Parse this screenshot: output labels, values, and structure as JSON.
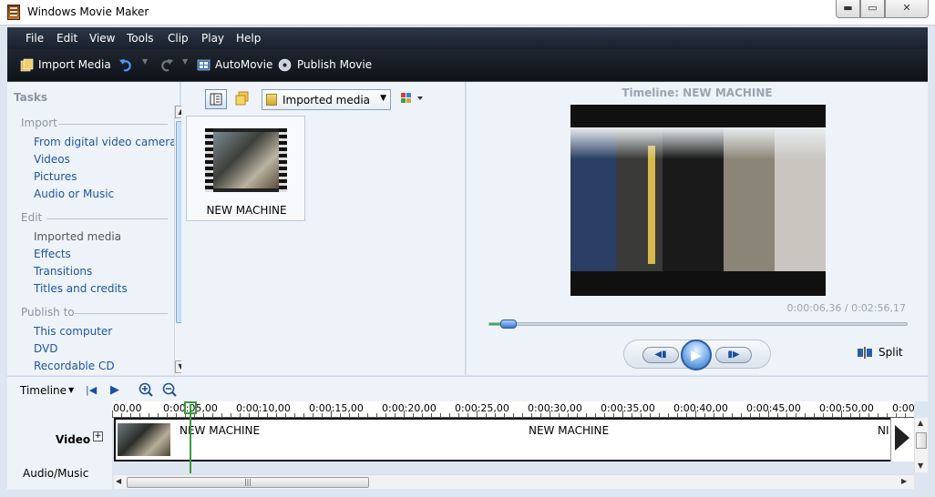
{
  "window": {
    "title": "Windows Movie Maker",
    "min_glyph": "▬",
    "max_glyph": "▭",
    "close_glyph": "✕"
  },
  "menu": [
    "File",
    "Edit",
    "View",
    "Tools",
    "Clip",
    "Play",
    "Help"
  ],
  "toolbar": {
    "import_media": "Import Media",
    "automovie": "AutoMovie",
    "publish_movie": "Publish Movie"
  },
  "tasks": {
    "header": "Tasks",
    "sections": [
      {
        "title": "Import",
        "links": [
          "From digital video camera",
          "Videos",
          "Pictures",
          "Audio or Music"
        ]
      },
      {
        "title": "Edit",
        "links": [
          "Imported media",
          "Effects",
          "Transitions",
          "Titles and credits"
        ]
      },
      {
        "title": "Publish to",
        "links": [
          "This computer",
          "DVD",
          "Recordable CD"
        ]
      }
    ]
  },
  "collection": {
    "dropdown_value": "Imported media",
    "clip_caption": "NEW MACHINE"
  },
  "preview": {
    "title": "Timeline: NEW MACHINE",
    "timecode": "0:00:06,36 / 0:02:56,17",
    "progress_fraction": 0.036,
    "split_label": "Split"
  },
  "timeline": {
    "label": "Timeline",
    "ruler_labels": [
      "00,00",
      "0:00:05,00",
      "0:00:10,00",
      "0:00:15,00",
      "0:00:20,00",
      "0:00:25,00",
      "0:00:30,00",
      "0:00:35,00",
      "0:00:40,00",
      "0:00:45,00",
      "0:00:50,00",
      "0:00"
    ],
    "video_label": "Video",
    "audio_label": "Audio/Music",
    "clip_label_1": "NEW MACHINE",
    "clip_label_2": "NEW MACHINE",
    "clip_label_3": "NI"
  }
}
